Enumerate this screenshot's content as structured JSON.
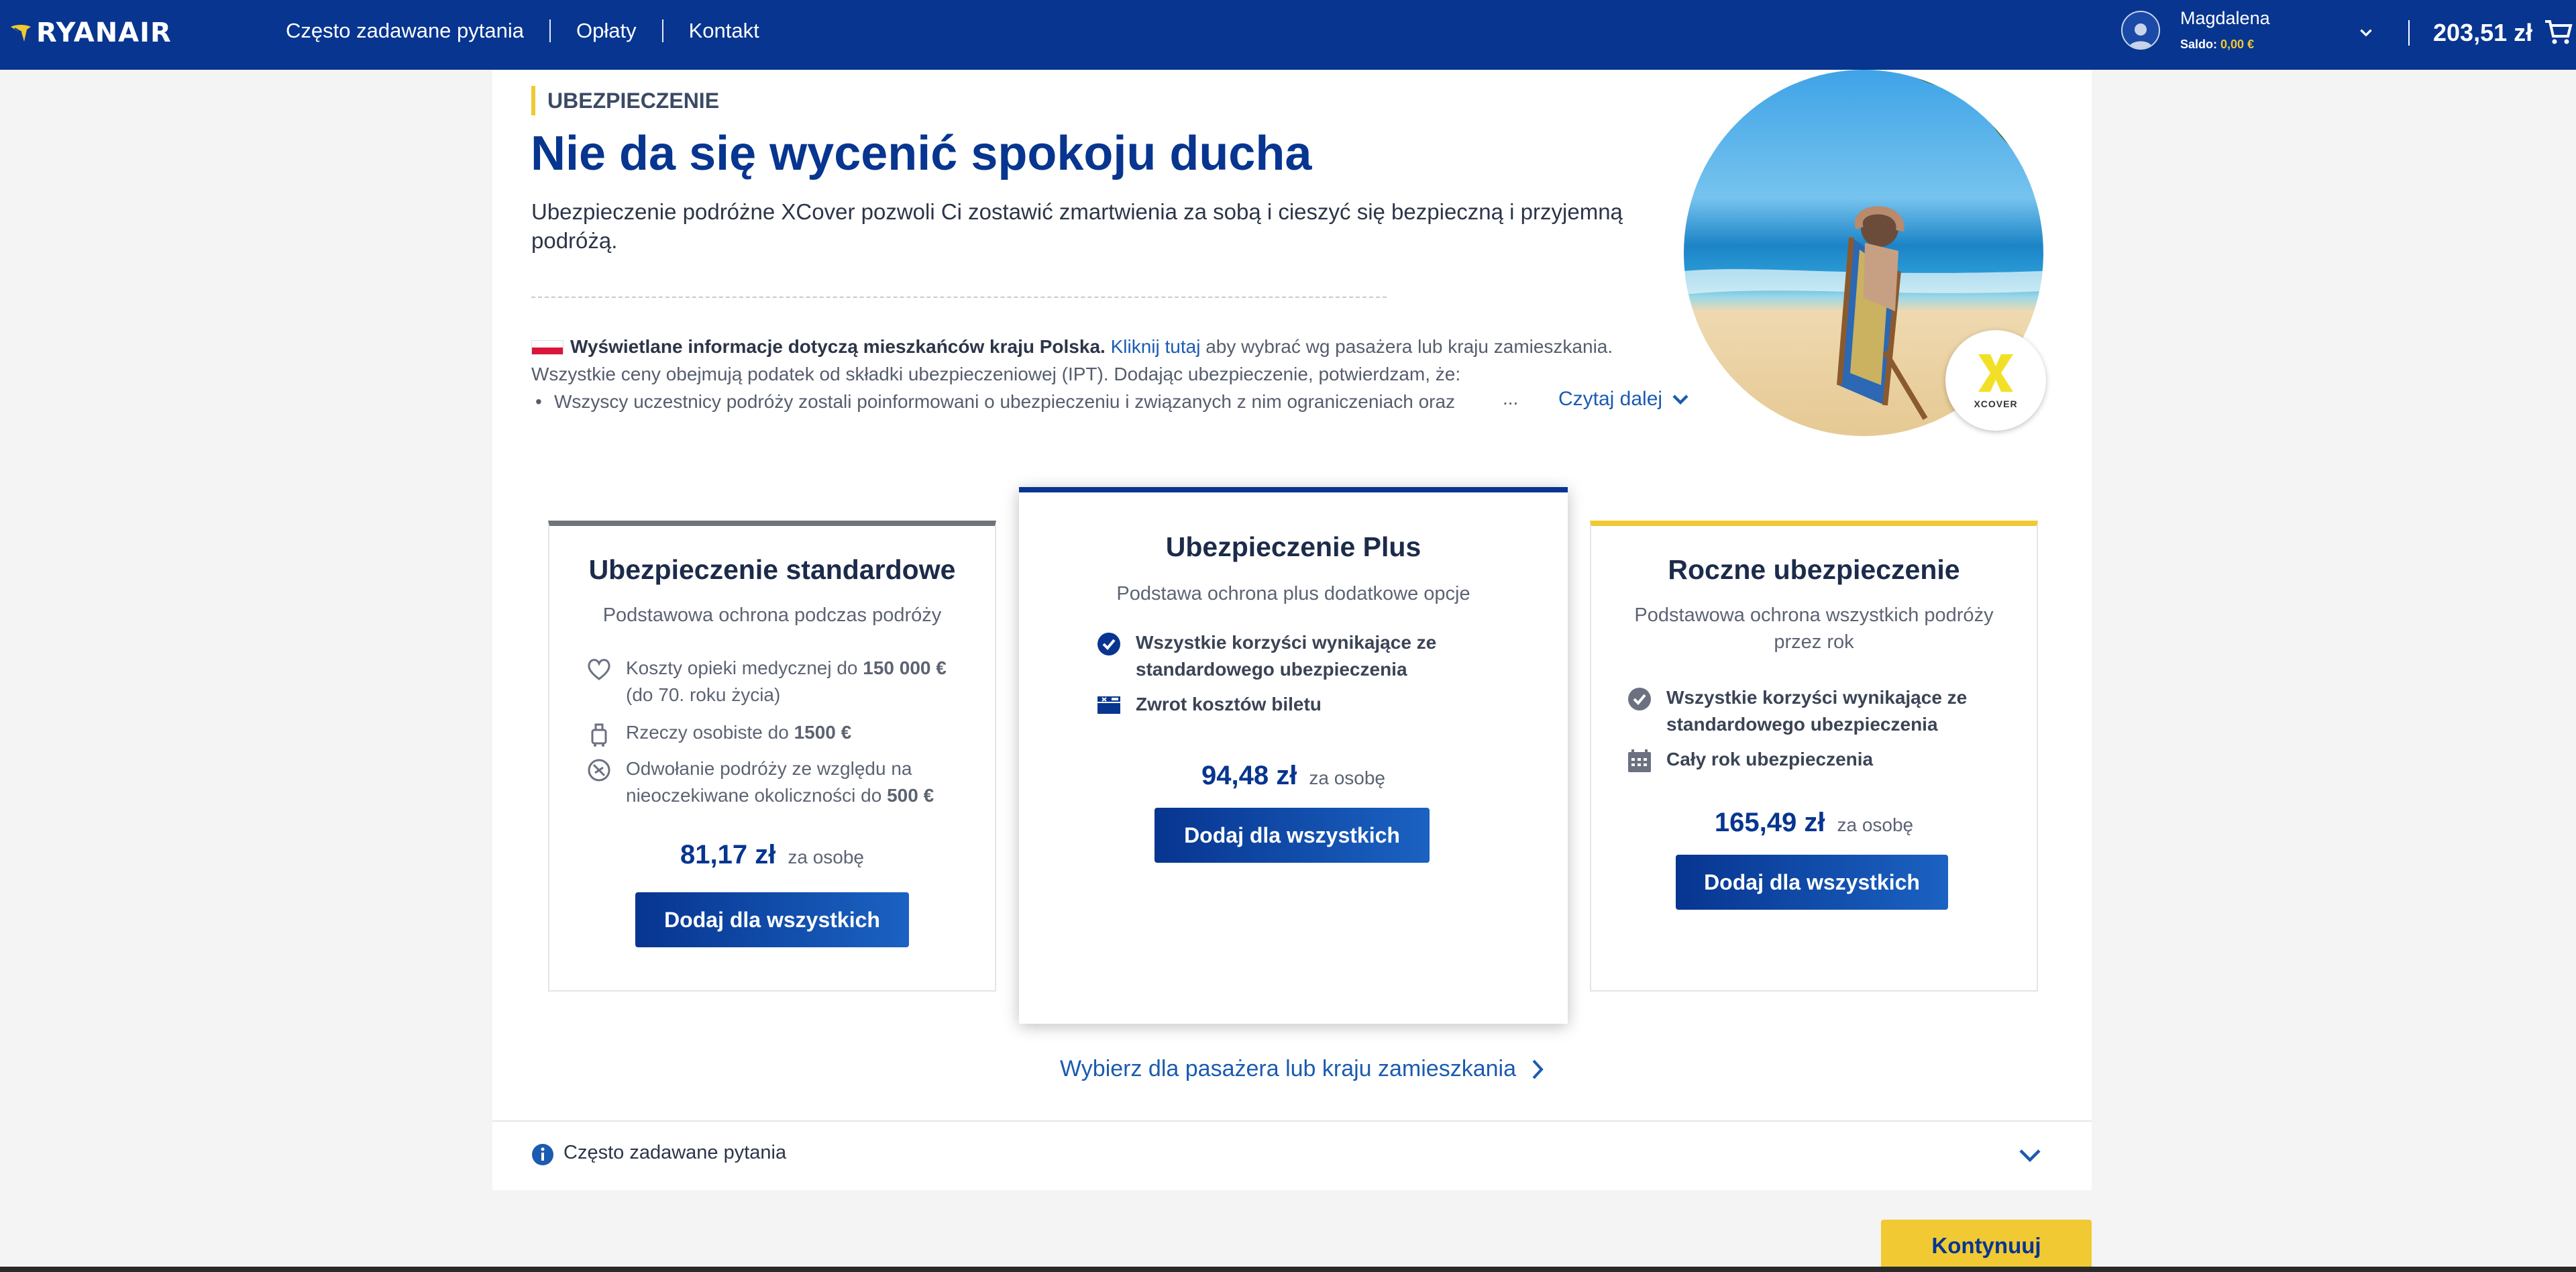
{
  "header": {
    "logo_text": "RYANAIR",
    "nav": [
      "Często zadawane pytania",
      "Opłaty",
      "Kontakt"
    ],
    "user_name": "Magdalena",
    "balance_label": "Saldo:",
    "balance_value": "0,00 €",
    "total": "203,51 zł",
    "icons": [
      "harp-logo-icon",
      "user-avatar-icon",
      "chevron-down-icon",
      "cart-icon"
    ]
  },
  "hero": {
    "kicker": "UBEZPIECZENIE",
    "title": "Nie da się wycenić spokoju ducha",
    "description": "Ubezpieczenie podróżne XCover pozwoli Ci zostawić zmartwienia za sobą i cieszyć się bezpieczną i przyjemną podróżą.",
    "residence_bold": "Wyświetlane informacje dotyczą mieszkańców kraju Polska.",
    "residence_link": "Kliknij tutaj",
    "residence_rest": " aby wybrać wg pasażera lub kraju zamieszkania.",
    "tax_note": "Wszystkie ceny obejmują podatek od składki ubezpieczeniowej (IPT). Dodając ubezpieczenie, potwierdzam, że:",
    "bullet": "Wszyscy uczestnicy podróży zostali poinformowani o ubezpieczeniu i związanych z nim ograniczeniach oraz",
    "ellipsis": "...",
    "read_more": "Czytaj dalej",
    "badge_text": "XCOVER"
  },
  "cards": [
    {
      "title": "Ubezpieczenie standardowe",
      "subtitle": "Podstawowa ochrona podczas podróży",
      "features": [
        {
          "icon": "heart-icon",
          "pre": "Koszty opieki medycznej do ",
          "bold": "150 000 €",
          "post": " (do 70. roku życia)"
        },
        {
          "icon": "luggage-icon",
          "pre": "Rzeczy osobiste do ",
          "bold": "1500 €",
          "post": ""
        },
        {
          "icon": "cancel-trip-icon",
          "pre": "Odwołanie podróży ze względu na nieoczekiwane okoliczności do ",
          "bold": "500 €",
          "post": ""
        }
      ],
      "price": "81,17 zł",
      "per": "za osobę",
      "button": "Dodaj dla wszystkich"
    },
    {
      "title": "Ubezpieczenie Plus",
      "subtitle": "Podstawa ochrona plus dodatkowe opcje",
      "features": [
        {
          "icon": "check-circle-icon",
          "text": "Wszystkie korzyści wynikające ze standardowego ubezpieczenia"
        },
        {
          "icon": "ticket-refund-icon",
          "text": "Zwrot kosztów biletu"
        }
      ],
      "price": "94,48 zł",
      "per": "za osobę",
      "button": "Dodaj dla wszystkich"
    },
    {
      "title": "Roczne ubezpieczenie",
      "subtitle": "Podstawowa ochrona wszystkich podróży przez rok",
      "features": [
        {
          "icon": "check-circle-icon",
          "text": "Wszystkie korzyści wynikające ze standardowego ubezpieczenia"
        },
        {
          "icon": "calendar-icon",
          "text": "Cały rok ubezpieczenia"
        }
      ],
      "price": "165,49 zł",
      "per": "za osobę",
      "button": "Dodaj dla wszystkich"
    }
  ],
  "choose_link": "Wybierz dla pasażera lub kraju zamieszkania",
  "faq": "Często zadawane pytania",
  "continue": "Kontynuuj",
  "colors": {
    "brand_blue": "#073590",
    "accent_yellow": "#f1c933",
    "link_blue": "#1b5bb0"
  }
}
